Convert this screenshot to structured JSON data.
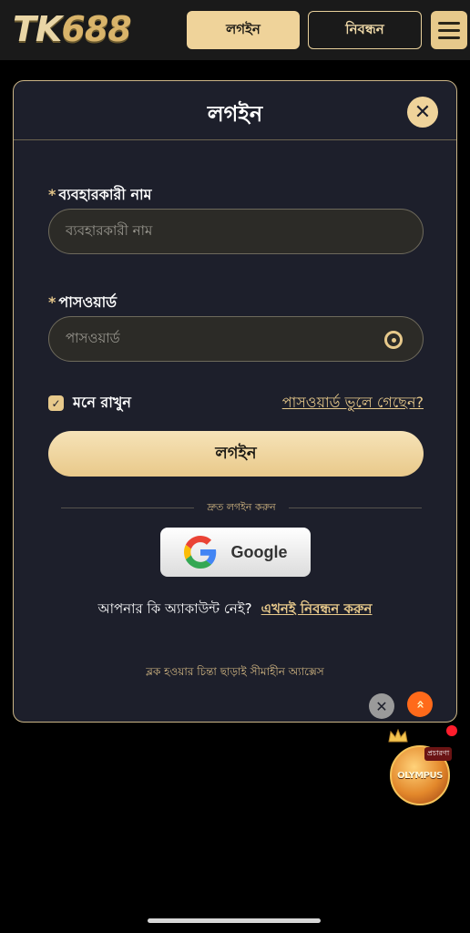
{
  "header": {
    "logo_letters": "TK",
    "logo_digits": "688",
    "login_label": "লগইন",
    "register_label": "নিবন্ধন"
  },
  "modal": {
    "title": "লগইন",
    "close_symbol": "✕",
    "username_label": "ব্যবহারকারী নাম",
    "username_placeholder": "ব্যবহারকারী নাম",
    "password_label": "পাসওয়ার্ড",
    "password_placeholder": "পাসওয়ার্ড",
    "required_mark": "*",
    "remember_label": "মনে রাখুন",
    "remember_checked": true,
    "forgot_label": "পাসওয়ার্ড ভুলে গেছেন?",
    "login_button": "লগইন",
    "quick_login_label": "দ্রুত লগইন করুন",
    "google_label": "Google",
    "no_account_text": "আপনার কি অ্যাকাউন্ট নেই?",
    "register_now_label": "এখনই নিবন্ধন করুন",
    "footer_note": "ব্লক হওয়ার চিন্তা ছাড়াই সীমাহীন অ্যাক্সেস"
  },
  "floating": {
    "mini_close_symbol": "✕",
    "scroll_top_symbol": "»",
    "promo_badge": "প্রচারণা",
    "promo_title": "OLYMPUS"
  },
  "colors": {
    "accent_gold": "#e7c98b",
    "modal_bg": "#1d1f2b",
    "page_bg": "#000000",
    "orange": "#ff6a1a"
  }
}
